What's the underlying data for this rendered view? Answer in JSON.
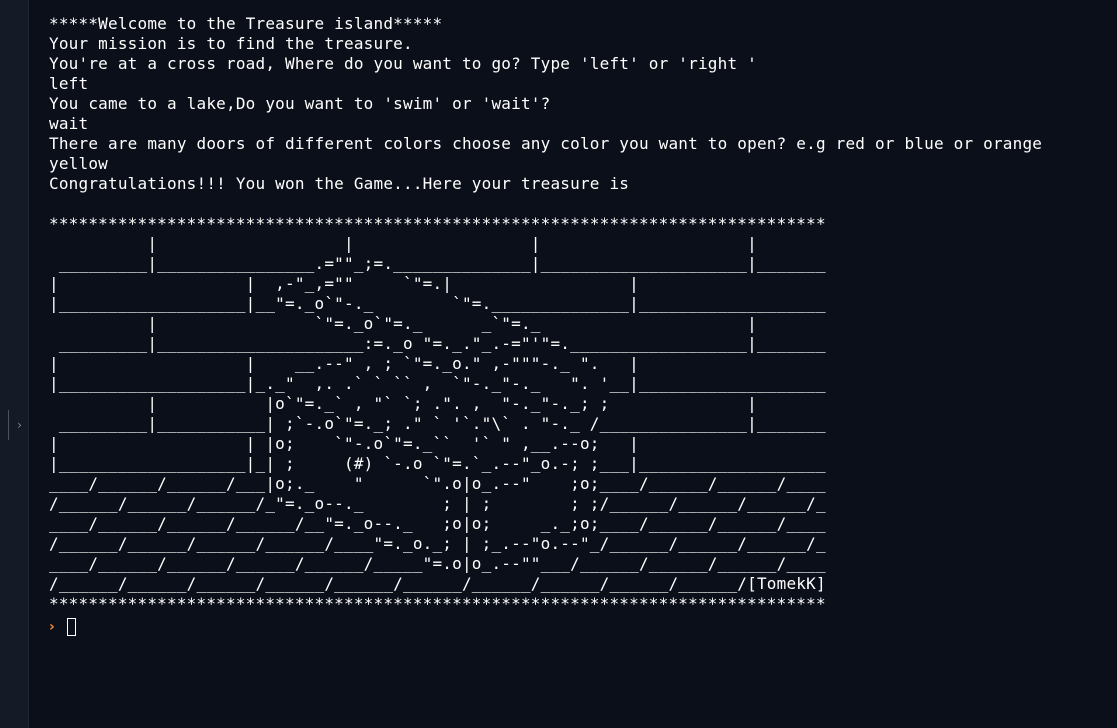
{
  "sidebar": {
    "collapse_icon": "chevron-right-icon",
    "collapse_glyph": "›"
  },
  "terminal": {
    "lines": [
      "*****Welcome to the Treasure island*****",
      "Your mission is to find the treasure.",
      "You're at a cross road, Where do you want to go? Type 'left' or 'right '",
      "left",
      "You came to a lake,Do you want to 'swim' or 'wait'?",
      "wait",
      "There are many doors of different colors choose any color you want to open? e.g red or blue or orange",
      "yellow",
      "Congratulations!!! You won the Game...Here your treasure is"
    ],
    "ascii_art": "*******************************************************************************\n          |                   |                  |                     |\n _________|________________.=\"\"_;=.______________|_____________________|_______\n|                   |  ,-\"_,=\"\"     `\"=.|                  |\n|___________________|__\"=._o`\"-._        `\"=.______________|___________________\n          |                `\"=._o`\"=._      _`\"=._                     |\n _________|_____________________:=._o \"=._.\"_.-=\"'\"=.__________________|_______\n|                   |    __.--\" , ; `\"=._o.\" ,-\"\"\"-._ \".   |\n|___________________|_._\"  ,. .` ` `` ,  `\"-._\"-._   \". '__|___________________\n          |           |o`\"=._` , \"` `; .\". ,  \"-._\"-._; ;              |\n _________|___________| ;`-.o`\"=._; .\" ` '`.\"\\` . \"-._ /_______________|_______\n|                   | |o;    `\"-.o`\"=._``  '` \" ,__.--o;   |\n|___________________|_| ;     (#) `-.o `\"=.`_.--\"_o.-; ;___|___________________\n____/______/______/___|o;._    \"      `\".o|o_.--\"    ;o;____/______/______/____\n/______/______/______/_\"=._o--._        ; | ;        ; ;/______/______/______/_\n____/______/______/______/__\"=._o--._   ;o|o;     _._;o;____/______/______/____\n/______/______/______/______/____\"=._o._; | ;_.--\"o.--\"_/______/______/______/_\n____/______/______/______/______/_____\"=.o|o_.--\"\"___/______/______/______/____\n/______/______/______/______/______/______/______/______/______/______/[TomekK]\n*******************************************************************************",
    "prompt_symbol": "›",
    "input_value": ""
  },
  "colors": {
    "background": "#0b0f1a",
    "text": "#ffffff",
    "prompt": "#f0883e",
    "rail": "#141a26"
  }
}
